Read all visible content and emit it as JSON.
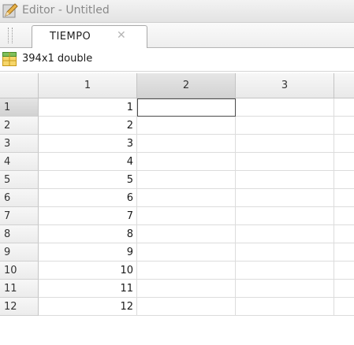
{
  "window": {
    "title": "Editor - Untitled",
    "icon": "pencil-editor-icon"
  },
  "tab": {
    "label": "TIEMPO",
    "close_glyph": "✕"
  },
  "info": {
    "size_label": "394x1 double",
    "icon": "grid-variable-icon"
  },
  "columns": [
    "1",
    "2",
    "3"
  ],
  "selected_column": "2",
  "selected_row": "1",
  "active_cell": {
    "row": "1",
    "column": "2"
  },
  "rows": [
    {
      "index": "1",
      "values": [
        "1"
      ]
    },
    {
      "index": "2",
      "values": [
        "2"
      ]
    },
    {
      "index": "3",
      "values": [
        "3"
      ]
    },
    {
      "index": "4",
      "values": [
        "4"
      ]
    },
    {
      "index": "5",
      "values": [
        "5"
      ]
    },
    {
      "index": "6",
      "values": [
        "6"
      ]
    },
    {
      "index": "7",
      "values": [
        "7"
      ]
    },
    {
      "index": "8",
      "values": [
        "8"
      ]
    },
    {
      "index": "9",
      "values": [
        "9"
      ]
    },
    {
      "index": "10",
      "values": [
        "10"
      ]
    },
    {
      "index": "11",
      "values": [
        "11"
      ]
    },
    {
      "index": "12",
      "values": [
        "12"
      ]
    }
  ],
  "colors": {
    "selection_header": "#d6d6d6",
    "grid_line": "#dcdcdc"
  }
}
